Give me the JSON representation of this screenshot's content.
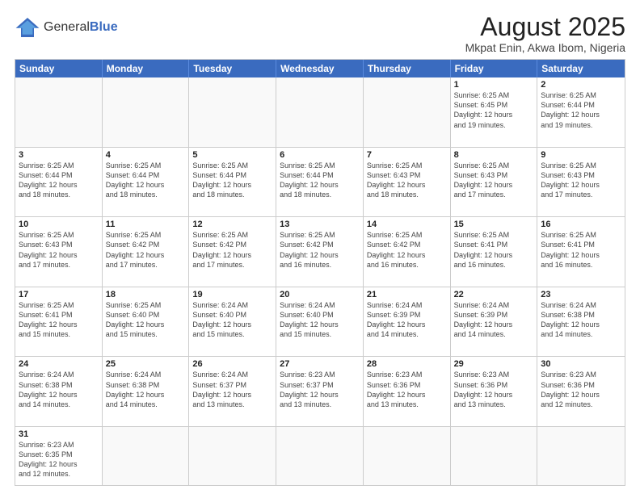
{
  "header": {
    "logo_general": "General",
    "logo_blue": "Blue",
    "title": "August 2025",
    "subtitle": "Mkpat Enin, Akwa Ibom, Nigeria"
  },
  "days_of_week": [
    "Sunday",
    "Monday",
    "Tuesday",
    "Wednesday",
    "Thursday",
    "Friday",
    "Saturday"
  ],
  "weeks": [
    [
      {
        "day": "",
        "info": ""
      },
      {
        "day": "",
        "info": ""
      },
      {
        "day": "",
        "info": ""
      },
      {
        "day": "",
        "info": ""
      },
      {
        "day": "",
        "info": ""
      },
      {
        "day": "1",
        "info": "Sunrise: 6:25 AM\nSunset: 6:45 PM\nDaylight: 12 hours\nand 19 minutes."
      },
      {
        "day": "2",
        "info": "Sunrise: 6:25 AM\nSunset: 6:44 PM\nDaylight: 12 hours\nand 19 minutes."
      }
    ],
    [
      {
        "day": "3",
        "info": "Sunrise: 6:25 AM\nSunset: 6:44 PM\nDaylight: 12 hours\nand 18 minutes."
      },
      {
        "day": "4",
        "info": "Sunrise: 6:25 AM\nSunset: 6:44 PM\nDaylight: 12 hours\nand 18 minutes."
      },
      {
        "day": "5",
        "info": "Sunrise: 6:25 AM\nSunset: 6:44 PM\nDaylight: 12 hours\nand 18 minutes."
      },
      {
        "day": "6",
        "info": "Sunrise: 6:25 AM\nSunset: 6:44 PM\nDaylight: 12 hours\nand 18 minutes."
      },
      {
        "day": "7",
        "info": "Sunrise: 6:25 AM\nSunset: 6:43 PM\nDaylight: 12 hours\nand 18 minutes."
      },
      {
        "day": "8",
        "info": "Sunrise: 6:25 AM\nSunset: 6:43 PM\nDaylight: 12 hours\nand 17 minutes."
      },
      {
        "day": "9",
        "info": "Sunrise: 6:25 AM\nSunset: 6:43 PM\nDaylight: 12 hours\nand 17 minutes."
      }
    ],
    [
      {
        "day": "10",
        "info": "Sunrise: 6:25 AM\nSunset: 6:43 PM\nDaylight: 12 hours\nand 17 minutes."
      },
      {
        "day": "11",
        "info": "Sunrise: 6:25 AM\nSunset: 6:42 PM\nDaylight: 12 hours\nand 17 minutes."
      },
      {
        "day": "12",
        "info": "Sunrise: 6:25 AM\nSunset: 6:42 PM\nDaylight: 12 hours\nand 17 minutes."
      },
      {
        "day": "13",
        "info": "Sunrise: 6:25 AM\nSunset: 6:42 PM\nDaylight: 12 hours\nand 16 minutes."
      },
      {
        "day": "14",
        "info": "Sunrise: 6:25 AM\nSunset: 6:42 PM\nDaylight: 12 hours\nand 16 minutes."
      },
      {
        "day": "15",
        "info": "Sunrise: 6:25 AM\nSunset: 6:41 PM\nDaylight: 12 hours\nand 16 minutes."
      },
      {
        "day": "16",
        "info": "Sunrise: 6:25 AM\nSunset: 6:41 PM\nDaylight: 12 hours\nand 16 minutes."
      }
    ],
    [
      {
        "day": "17",
        "info": "Sunrise: 6:25 AM\nSunset: 6:41 PM\nDaylight: 12 hours\nand 15 minutes."
      },
      {
        "day": "18",
        "info": "Sunrise: 6:25 AM\nSunset: 6:40 PM\nDaylight: 12 hours\nand 15 minutes."
      },
      {
        "day": "19",
        "info": "Sunrise: 6:24 AM\nSunset: 6:40 PM\nDaylight: 12 hours\nand 15 minutes."
      },
      {
        "day": "20",
        "info": "Sunrise: 6:24 AM\nSunset: 6:40 PM\nDaylight: 12 hours\nand 15 minutes."
      },
      {
        "day": "21",
        "info": "Sunrise: 6:24 AM\nSunset: 6:39 PM\nDaylight: 12 hours\nand 14 minutes."
      },
      {
        "day": "22",
        "info": "Sunrise: 6:24 AM\nSunset: 6:39 PM\nDaylight: 12 hours\nand 14 minutes."
      },
      {
        "day": "23",
        "info": "Sunrise: 6:24 AM\nSunset: 6:38 PM\nDaylight: 12 hours\nand 14 minutes."
      }
    ],
    [
      {
        "day": "24",
        "info": "Sunrise: 6:24 AM\nSunset: 6:38 PM\nDaylight: 12 hours\nand 14 minutes."
      },
      {
        "day": "25",
        "info": "Sunrise: 6:24 AM\nSunset: 6:38 PM\nDaylight: 12 hours\nand 14 minutes."
      },
      {
        "day": "26",
        "info": "Sunrise: 6:24 AM\nSunset: 6:37 PM\nDaylight: 12 hours\nand 13 minutes."
      },
      {
        "day": "27",
        "info": "Sunrise: 6:23 AM\nSunset: 6:37 PM\nDaylight: 12 hours\nand 13 minutes."
      },
      {
        "day": "28",
        "info": "Sunrise: 6:23 AM\nSunset: 6:36 PM\nDaylight: 12 hours\nand 13 minutes."
      },
      {
        "day": "29",
        "info": "Sunrise: 6:23 AM\nSunset: 6:36 PM\nDaylight: 12 hours\nand 13 minutes."
      },
      {
        "day": "30",
        "info": "Sunrise: 6:23 AM\nSunset: 6:36 PM\nDaylight: 12 hours\nand 12 minutes."
      }
    ],
    [
      {
        "day": "31",
        "info": "Sunrise: 6:23 AM\nSunset: 6:35 PM\nDaylight: 12 hours\nand 12 minutes."
      },
      {
        "day": "",
        "info": ""
      },
      {
        "day": "",
        "info": ""
      },
      {
        "day": "",
        "info": ""
      },
      {
        "day": "",
        "info": ""
      },
      {
        "day": "",
        "info": ""
      },
      {
        "day": "",
        "info": ""
      }
    ]
  ]
}
